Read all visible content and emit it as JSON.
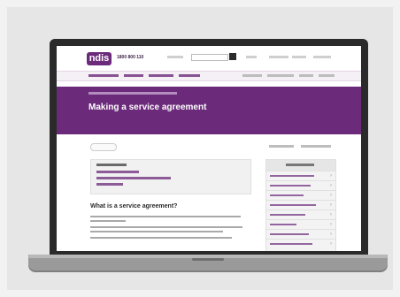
{
  "site": {
    "logo_text": "ndis",
    "phone": "1800 800 110",
    "page_title": "Making a service agreement",
    "section_heading": "What is a service agreement?"
  },
  "colors": {
    "brand": "#6b2a7a",
    "laptop_body": "#2a2a2a",
    "laptop_base": "#9a9a9a"
  },
  "icons": {
    "search": "search-icon",
    "chevron": "chevron-right-icon"
  }
}
